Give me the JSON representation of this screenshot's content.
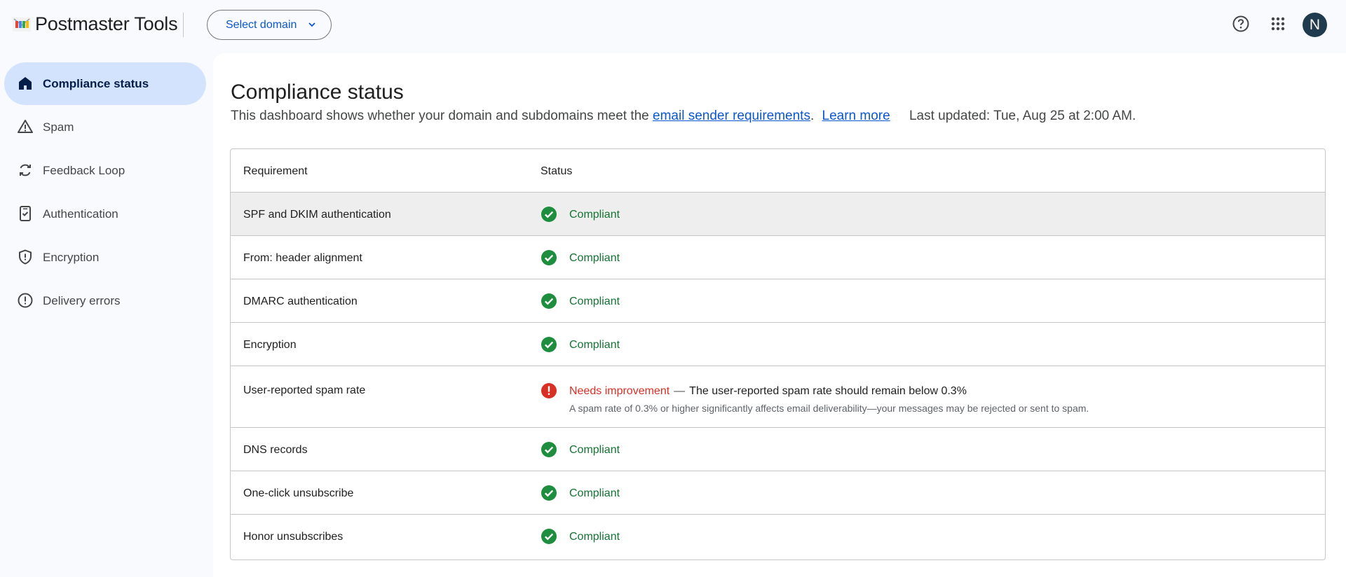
{
  "header": {
    "app_title": "Postmaster Tools",
    "domain_button": "Select domain",
    "avatar_letter": "N",
    "icons": [
      "logo-icon",
      "chevron-down-icon",
      "help-icon",
      "apps-grid-icon"
    ]
  },
  "sidebar": {
    "items": [
      {
        "label": "Compliance status",
        "icon": "home-icon",
        "active": true
      },
      {
        "label": "Spam",
        "icon": "warning-triangle-icon"
      },
      {
        "label": "Feedback Loop",
        "icon": "sync-icon"
      },
      {
        "label": "Authentication",
        "icon": "phone-check-icon"
      },
      {
        "label": "Encryption",
        "icon": "shield-icon"
      },
      {
        "label": "Delivery errors",
        "icon": "alert-circle-icon"
      }
    ]
  },
  "main": {
    "title": "Compliance status",
    "subtitle_prefix": "This dashboard shows whether your domain and subdomains meet the ",
    "requirements_link": "email sender requirements",
    "subtitle_period": ".",
    "learn_more": "Learn more",
    "last_updated": "Last updated: Tue, Aug 25 at 2:00 AM."
  },
  "table": {
    "headers": {
      "requirement": "Requirement",
      "status": "Status"
    },
    "rows": [
      {
        "requirement": "SPF and DKIM authentication",
        "status": "Compliant"
      },
      {
        "requirement": "From: header alignment",
        "status": "Compliant"
      },
      {
        "requirement": "DMARC authentication",
        "status": "Compliant"
      },
      {
        "requirement": "Encryption",
        "status": "Compliant"
      },
      {
        "requirement": "User-reported spam rate",
        "status": "Needs improvement",
        "dash": "—",
        "explanation": "The user-reported spam rate should remain below 0.3%",
        "detail": "A spam rate of 0.3% or higher significantly affects email deliverability—your messages may be rejected or sent to spam."
      },
      {
        "requirement": "DNS records",
        "status": "Compliant"
      },
      {
        "requirement": "One-click unsubscribe",
        "status": "Compliant"
      },
      {
        "requirement": "Honor unsubscribes",
        "status": "Compliant"
      }
    ]
  },
  "colors": {
    "accent": "#0b57d0",
    "active_nav": "#d3e3fd",
    "compliant": "#137333",
    "compliant_icon": "#1e8e3e",
    "error": "#d93025"
  }
}
